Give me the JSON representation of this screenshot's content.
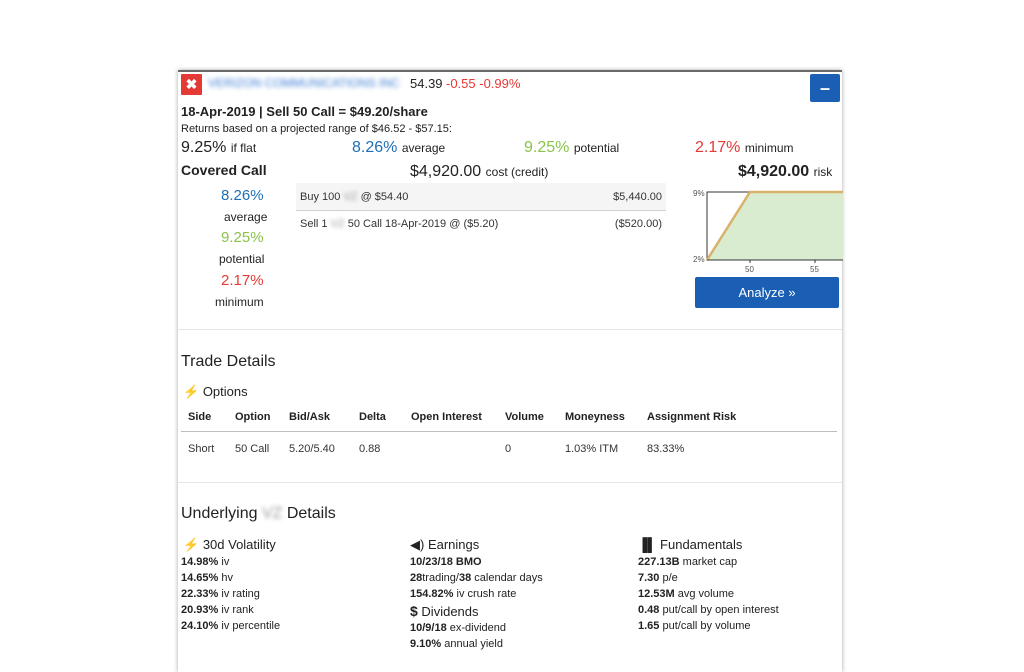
{
  "header": {
    "close_symbol": "✖",
    "ticker_name": "VERIZON COMMUNICATIONS INC",
    "price": "54.39",
    "change": "-0.55 -0.99%",
    "collapse_symbol": "–"
  },
  "summary": {
    "trade_line": "18-Apr-2019 | Sell 50 Call = $49.20/share",
    "range_note": "Returns based on a projected range of $46.52 - $57.15:",
    "if_flat_value": "9.25%",
    "if_flat_label": "if flat",
    "average_value": "8.26%",
    "average_label": "average",
    "potential_value": "9.25%",
    "potential_label": "potential",
    "minimum_value": "2.17%",
    "minimum_label": "minimum",
    "strategy_name": "Covered Call",
    "cost_value": "$4,920.00",
    "cost_label": "cost (credit)",
    "risk_value": "$4,920.00",
    "risk_label": "risk"
  },
  "side_stats": {
    "average_value": "8.26%",
    "average_label": "average",
    "potential_value": "9.25%",
    "potential_label": "potential",
    "minimum_value": "2.17%",
    "minimum_label": "minimum"
  },
  "legs": [
    {
      "pre": "Buy 100",
      "masked": "VZ",
      "post": "@ $54.40",
      "amount": "$5,440.00"
    },
    {
      "pre": "Sell 1",
      "masked": "VZ",
      "post": "50 Call 18-Apr-2019 @ ($5.20)",
      "amount": "($520.00)"
    }
  ],
  "mini_chart": {
    "y_top_label": "9%",
    "y_bottom_label": "2%",
    "x_labels": [
      "50",
      "55"
    ]
  },
  "analyze_button": "Analyze »",
  "trade_details": {
    "title": "Trade Details",
    "options_label": "Options",
    "columns": [
      "Side",
      "Option",
      "Bid/Ask",
      "Delta",
      "Open Interest",
      "Volume",
      "Moneyness",
      "Assignment Risk"
    ],
    "row": [
      "Short",
      "50 Call",
      "5.20/5.40",
      "0.88",
      "",
      "0",
      "1.03% ITM",
      "83.33%"
    ]
  },
  "underlying": {
    "title_pre": "Underlying",
    "title_masked": "VZ",
    "title_post": "Details",
    "volatility": {
      "title": "30d Volatility",
      "lines": [
        {
          "value": "14.98%",
          "label": "iv"
        },
        {
          "value": "14.65%",
          "label": "hv"
        },
        {
          "value": "22.33%",
          "label": "iv rating"
        },
        {
          "value": "20.93%",
          "label": "iv rank"
        },
        {
          "value": "24.10%",
          "label": "iv percentile"
        }
      ]
    },
    "earnings": {
      "title": "Earnings",
      "date": "10/23/18 BMO",
      "days_trading": "28",
      "days_trading_label": "trading/",
      "days_calendar": "38",
      "days_calendar_label": "calendar days",
      "crush_value": "154.82%",
      "crush_label": "iv crush rate"
    },
    "dividends": {
      "title": "Dividends",
      "ex_date": "10/9/18",
      "ex_label": "ex-dividend",
      "yield_value": "9.10%",
      "yield_label": "annual yield"
    },
    "fundamentals": {
      "title": "Fundamentals",
      "lines": [
        {
          "value": "227.13B",
          "label": "market cap"
        },
        {
          "value": "7.30",
          "label": "p/e"
        },
        {
          "value": "12.53M",
          "label": "avg volume"
        },
        {
          "value": "0.48",
          "label": "put/call by open interest"
        },
        {
          "value": "1.65",
          "label": "put/call by volume"
        }
      ]
    }
  }
}
